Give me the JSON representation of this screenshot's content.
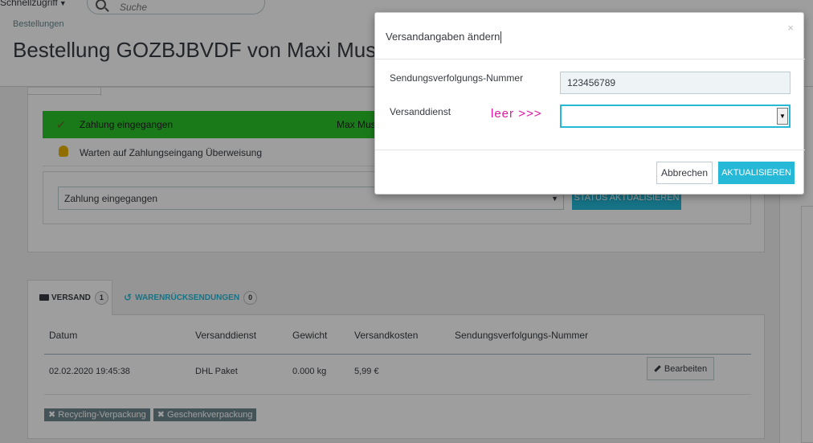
{
  "header": {
    "quick_access_label": "Schnellzugriff",
    "search_placeholder": "Suche",
    "breadcrumb": "Bestellungen",
    "page_title": "Bestellung GOZBJBVDF von Maxi Musterr"
  },
  "order_status": {
    "rows": [
      {
        "label": "Zahlung eingegangen",
        "employee": "Max Must",
        "color": "#2ac52a",
        "icon": "check-icon"
      },
      {
        "label": "Warten auf Zahlungseingang Überweisung",
        "icon": "coins-icon"
      }
    ],
    "select_value": "Zahlung eingegangen",
    "update_button": "STATUS AKTUALISIEREN"
  },
  "shipping": {
    "tabs": [
      {
        "label": "VERSAND",
        "count": "1",
        "icon": "truck-icon"
      },
      {
        "label": "WARENRÜCKSENDUNGEN",
        "count": "0",
        "icon": "return-icon"
      }
    ],
    "columns": [
      "Datum",
      "Versanddienst",
      "Gewicht",
      "Versandkosten",
      "Sendungsverfolgungs-Nummer"
    ],
    "rows": [
      {
        "date": "02.02.2020 19:45:38",
        "carrier": "DHL Paket",
        "weight": "0.000 kg",
        "cost": "5,99 €",
        "tracking": ""
      }
    ],
    "edit_button": "Bearbeiten",
    "tags": [
      "Recycling-Verpackung",
      "Geschenkverpackung"
    ]
  },
  "modal": {
    "title": "Versandangaben ändern",
    "close_symbol": "×",
    "tracking_label": "Sendungsverfolgungs-Nummer",
    "tracking_value": "123456789",
    "carrier_label": "Versanddienst",
    "annotation": "leer >>>",
    "carrier_value": "",
    "cancel_button": "Abbrechen",
    "update_button": "AKTUALISIEREN"
  },
  "colors": {
    "accent": "#25b9d7",
    "success": "#2ac52a",
    "annotation": "#e0169e"
  }
}
